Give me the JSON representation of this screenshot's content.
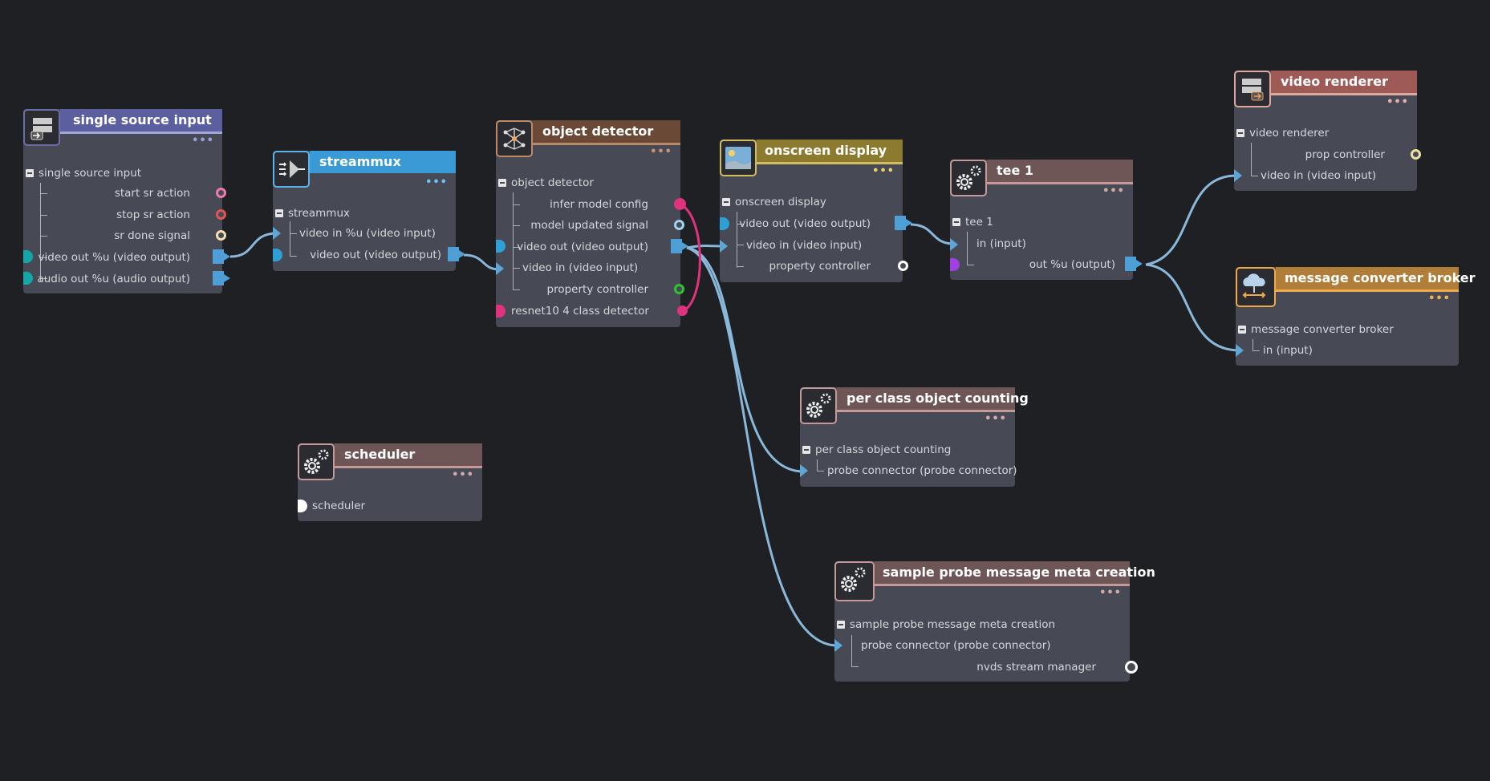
{
  "nodes": {
    "single_source": {
      "title": "single source input",
      "group": "single source input",
      "rows": [
        "start sr action",
        "stop sr action",
        "sr done signal",
        "video out %u (video output)",
        "audio out %u (audio output)"
      ]
    },
    "streammux": {
      "title": "streammux",
      "group": "streammux",
      "rows": [
        "video in %u (video input)",
        "video out (video output)"
      ]
    },
    "object_detector": {
      "title": "object detector",
      "group": "object detector",
      "rows": [
        "infer model config",
        "model updated signal",
        "video out (video output)",
        "video in (video input)",
        "property controller",
        "resnet10 4 class detector"
      ]
    },
    "onscreen_display": {
      "title": "onscreen display",
      "group": "onscreen display",
      "rows": [
        "video out (video output)",
        "video in (video input)",
        "property controller"
      ]
    },
    "tee": {
      "title": "tee 1",
      "group": "tee 1",
      "rows": [
        "in (input)",
        "out %u (output)"
      ]
    },
    "video_renderer": {
      "title": "video renderer",
      "group": "video renderer",
      "rows": [
        "prop controller",
        "video in (video input)"
      ]
    },
    "msg_broker": {
      "title": "message converter broker",
      "group": "message converter broker",
      "rows": [
        "in (input)"
      ]
    },
    "per_class": {
      "title": "per class object counting",
      "group": "per class object counting",
      "rows": [
        "probe connector (probe connector)"
      ]
    },
    "scheduler": {
      "title": "scheduler",
      "rows": [
        "scheduler"
      ]
    },
    "sample_probe": {
      "title": "sample probe message meta creation",
      "group": "sample probe message meta creation",
      "rows": [
        "probe connector (probe connector)",
        "nvds stream manager"
      ]
    }
  },
  "more_glyph": "•••",
  "colors": {
    "background": "#1f2023",
    "node_body": "#474a55",
    "wire": "#8ab8da",
    "wire_signal": "#e0337f",
    "single_source_header": "#5b5f9f",
    "streammux_header": "#3a9ad6",
    "object_detector_header": "#6a4a36",
    "onscreen_display_header": "#8c7a2e",
    "generic_header": "#6e5556",
    "video_renderer_header": "#9e5a55",
    "msg_broker_header": "#b07e38"
  }
}
